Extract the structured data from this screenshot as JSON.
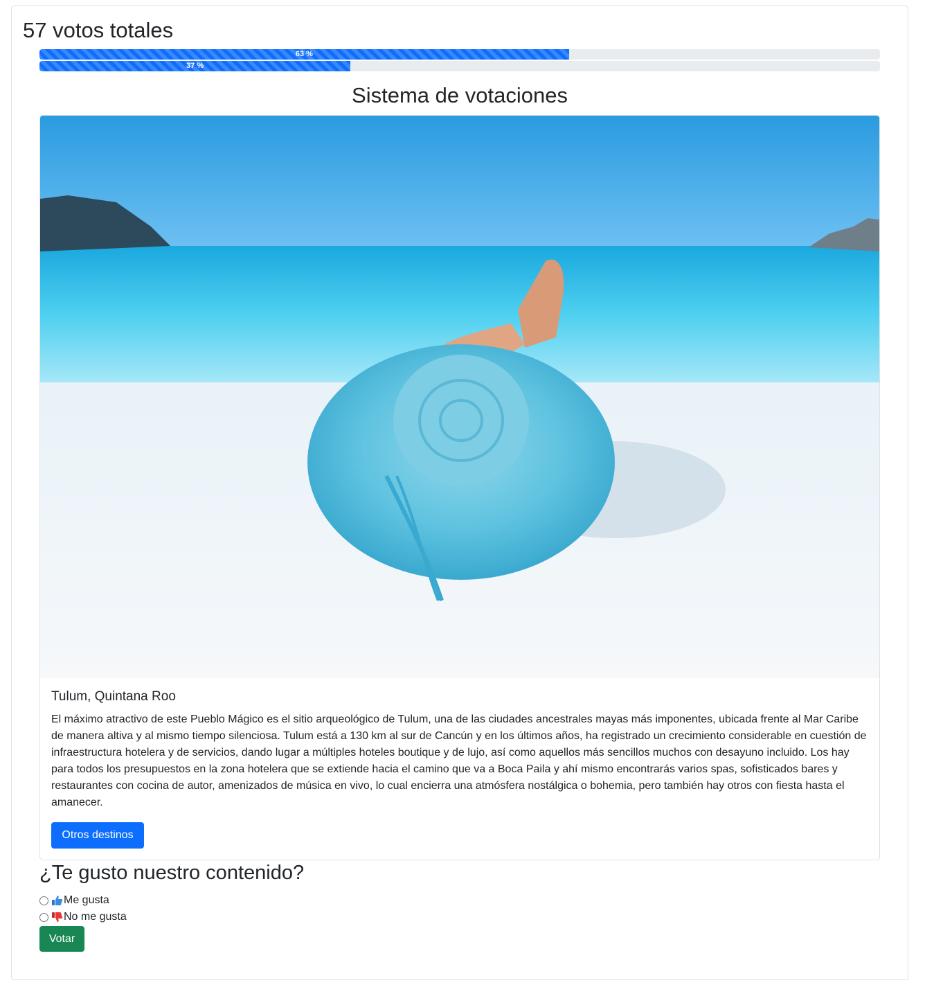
{
  "votes": {
    "total_label": "57 votos totales",
    "bars": [
      {
        "label": "63 %",
        "percent": 63
      },
      {
        "label": "37 %",
        "percent": 37
      }
    ],
    "bar_color": "#0d6efd"
  },
  "title": "Sistema de votaciones",
  "card": {
    "image_icon": "beach-hat-photo",
    "heading": "Tulum, Quintana Roo",
    "text": "El máximo atractivo de este Pueblo Mágico es el sitio arqueológico de Tulum, una de las ciudades ancestrales mayas más imponentes, ubicada frente al Mar Caribe de manera altiva y al mismo tiempo silenciosa. Tulum está a 130 km al sur de Cancún y en los últimos años, ha registrado un crecimiento considerable en cuestión de infraestructura hotelera y de servicios, dando lugar a múltiples hoteles boutique y de lujo, así como aquellos más sencillos muchos con desayuno incluido. Los hay para todos los presupuestos en la zona hotelera que se extiende hacia el camino que va a Boca Paila y ahí mismo encontrarás varios spas, sofisticados bares y restaurantes con cocina de autor, amenizados de música en vivo, lo cual encierra una atmósfera nostálgica o bohemia, pero también hay otros con fiesta hasta el amanecer.",
    "button_label": "Otros destinos"
  },
  "poll": {
    "question": "¿Te gusto nuestro contenido?",
    "options": [
      {
        "label": "Me gusta",
        "icon": "thumbs-up-icon"
      },
      {
        "label": "No me gusta",
        "icon": "thumbs-down-icon"
      }
    ],
    "submit_label": "Votar"
  }
}
